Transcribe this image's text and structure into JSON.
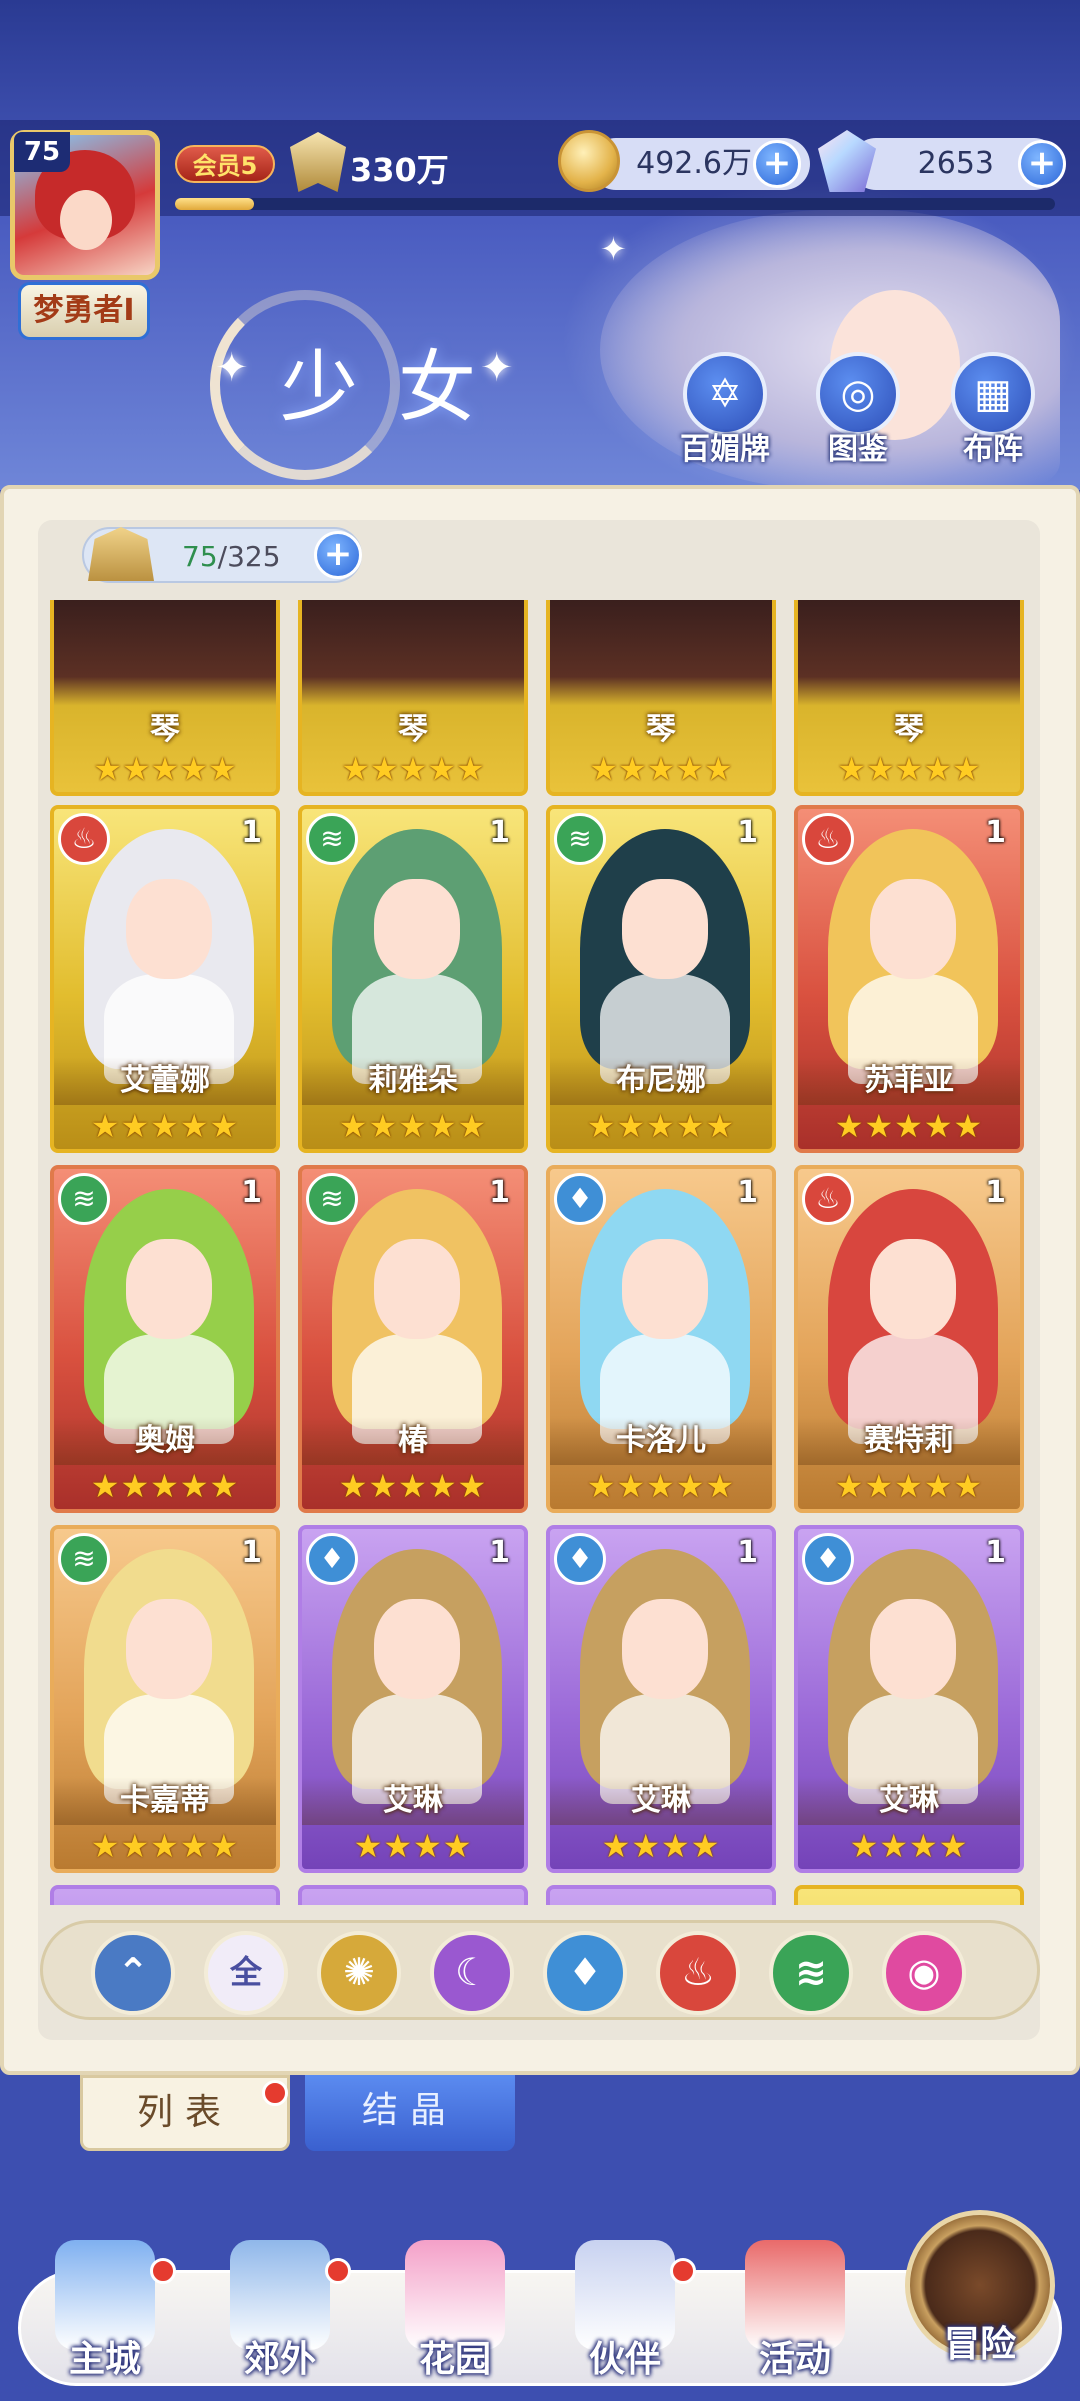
{
  "header": {
    "level": "75",
    "player_name": "梦勇者I",
    "vip_label": "会员5",
    "power": "330万",
    "xp_progress": 0.09,
    "gold": "492.6万",
    "gems": "2653",
    "plus": "+"
  },
  "page_title": "少女",
  "top_buttons": [
    {
      "label": "百媚牌",
      "icon": "seal-icon",
      "glyph": "✡"
    },
    {
      "label": "图鉴",
      "icon": "book-icon",
      "glyph": "◎"
    },
    {
      "label": "布阵",
      "icon": "grid-icon",
      "glyph": "▦"
    }
  ],
  "capacity": {
    "current": "75",
    "separator": "/",
    "max": "325",
    "plus": "+"
  },
  "top_partial_cards": [
    {
      "name": "琴",
      "stars": "★★★★★"
    },
    {
      "name": "琴",
      "stars": "★★★★★"
    },
    {
      "name": "琴",
      "stars": "★★★★★"
    },
    {
      "name": "琴",
      "stars": "★★★★★"
    }
  ],
  "cards": [
    {
      "name": "艾蕾娜",
      "count": "1",
      "stars": "★★★★★",
      "element": "fire",
      "elem_glyph": "♨",
      "elem_color": "#d9473c",
      "frame": "gold",
      "hair": "#e9e9ef"
    },
    {
      "name": "莉雅朵",
      "count": "1",
      "stars": "★★★★★",
      "element": "wind",
      "elem_glyph": "≋",
      "elem_color": "#3aa457",
      "frame": "gold",
      "hair": "#5d9f73"
    },
    {
      "name": "布尼娜",
      "count": "1",
      "stars": "★★★★★",
      "element": "wind",
      "elem_glyph": "≋",
      "elem_color": "#3aa457",
      "frame": "gold",
      "hair": "#1f3f4a"
    },
    {
      "name": "苏菲亚",
      "count": "1",
      "stars": "★★★★★",
      "element": "fire",
      "elem_glyph": "♨",
      "elem_color": "#d9473c",
      "frame": "red",
      "hair": "#f1c45a"
    },
    {
      "name": "奥姆",
      "count": "1",
      "stars": "★★★★★",
      "element": "wind",
      "elem_glyph": "≋",
      "elem_color": "#3aa457",
      "frame": "red",
      "hair": "#96cf4a"
    },
    {
      "name": "椿",
      "count": "1",
      "stars": "★★★★★",
      "element": "wind",
      "elem_glyph": "≋",
      "elem_color": "#3aa457",
      "frame": "red",
      "hair": "#f0c262"
    },
    {
      "name": "卡洛儿",
      "count": "1",
      "stars": "★★★★★",
      "element": "water",
      "elem_glyph": "♦",
      "elem_color": "#3f8fd6",
      "frame": "orange",
      "hair": "#8fd8f2"
    },
    {
      "name": "赛特莉",
      "count": "1",
      "stars": "★★★★★",
      "element": "fire",
      "elem_glyph": "♨",
      "elem_color": "#d9473c",
      "frame": "orange",
      "hair": "#d8463e"
    },
    {
      "name": "卡嘉蒂",
      "count": "1",
      "stars": "★★★★★",
      "element": "wind",
      "elem_glyph": "≋",
      "elem_color": "#3aa457",
      "frame": "orange",
      "hair": "#f1dc8e"
    },
    {
      "name": "艾琳",
      "count": "1",
      "stars": "★★★★",
      "element": "water",
      "elem_glyph": "♦",
      "elem_color": "#3f8fd6",
      "frame": "purple",
      "hair": "#c6a060"
    },
    {
      "name": "艾琳",
      "count": "1",
      "stars": "★★★★",
      "element": "water",
      "elem_glyph": "♦",
      "elem_color": "#3f8fd6",
      "frame": "purple",
      "hair": "#c6a060"
    },
    {
      "name": "艾琳",
      "count": "1",
      "stars": "★★★★",
      "element": "water",
      "elem_glyph": "♦",
      "elem_color": "#3f8fd6",
      "frame": "purple",
      "hair": "#c6a060"
    }
  ],
  "filters": [
    {
      "key": "up",
      "icon": "chevron-up-icon",
      "glyph": "⌃",
      "color": "#4a7ac4"
    },
    {
      "key": "all",
      "label": "全",
      "icon": "all-filter-icon",
      "color": "#f1ecf8",
      "text_color": "#4a4fa0"
    },
    {
      "key": "light",
      "icon": "sun-icon",
      "glyph": "✺",
      "color": "#d6a93a"
    },
    {
      "key": "dark",
      "icon": "moon-icon",
      "glyph": "☾",
      "color": "#9a58d0"
    },
    {
      "key": "water",
      "icon": "water-drop-icon",
      "glyph": "♦",
      "color": "#3f8fd6"
    },
    {
      "key": "fire",
      "icon": "fire-icon",
      "glyph": "♨",
      "color": "#d9473c"
    },
    {
      "key": "wind",
      "icon": "wind-icon",
      "glyph": "≋",
      "color": "#3aa457"
    },
    {
      "key": "spirit",
      "icon": "orb-icon",
      "glyph": "◉",
      "color": "#e04aa0"
    }
  ],
  "tabs": {
    "list": "列表",
    "crystal": "结晶"
  },
  "nav": [
    {
      "label": "主城",
      "icon": "castle-icon",
      "badge": true
    },
    {
      "label": "郊外",
      "icon": "portal-icon",
      "badge": true
    },
    {
      "label": "花园",
      "icon": "heart-icon",
      "badge": false
    },
    {
      "label": "伙伴",
      "icon": "partner-icon",
      "badge": true,
      "active": true
    },
    {
      "label": "活动",
      "icon": "gift-icon",
      "badge": false
    },
    {
      "label": "冒险",
      "icon": "compass-icon",
      "badge": false
    }
  ]
}
